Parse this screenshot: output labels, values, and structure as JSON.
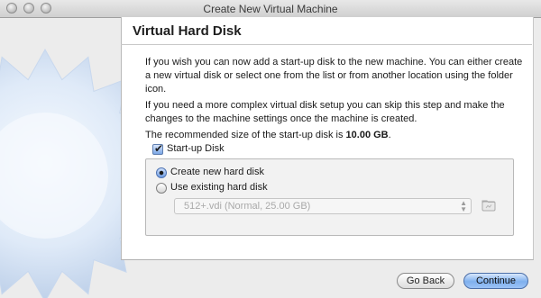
{
  "window": {
    "title": "Create New Virtual Machine"
  },
  "page": {
    "heading": "Virtual Hard Disk",
    "paragraph1": "If you wish you can now add a start-up disk to the new machine. You can either create a new virtual disk or select one from the list or from another location using the folder icon.",
    "paragraph2": "If you need a more complex virtual disk setup you can skip this step and make the changes to the machine settings once the machine is created.",
    "recommended_prefix": "The recommended size of the start-up disk is ",
    "recommended_size": "10.00 GB",
    "recommended_suffix": "."
  },
  "startup_disk": {
    "label": "Start-up Disk",
    "checked": true
  },
  "options": {
    "create_new": {
      "label": "Create new hard disk",
      "selected": true
    },
    "use_existing": {
      "label": "Use existing hard disk",
      "selected": false
    },
    "existing_select_value": "512+.vdi (Normal, 25.00 GB)",
    "folder_icon": "folder-icon"
  },
  "buttons": {
    "back": "Go Back",
    "continue": "Continue"
  },
  "colors": {
    "accent": "#7fb0ee",
    "heading": "#1f1f1f"
  }
}
